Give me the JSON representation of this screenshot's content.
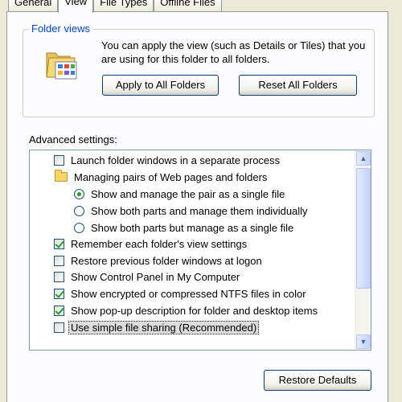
{
  "tabs": [
    {
      "label": "General",
      "active": false
    },
    {
      "label": "View",
      "active": true
    },
    {
      "label": "File Types",
      "active": false
    },
    {
      "label": "Offline Files",
      "active": false
    }
  ],
  "folder_views": {
    "title": "Folder views",
    "icon": "folder-views-icon",
    "description": "You can apply the view (such as Details or Tiles) that you are using for this folder to all folders.",
    "apply_label": "Apply to All Folders",
    "reset_label": "Reset All Folders"
  },
  "advanced": {
    "label": "Advanced settings:",
    "items": [
      {
        "type": "checkbox",
        "checked": false,
        "label": "Launch folder windows in a separate process"
      },
      {
        "type": "folder",
        "label": "Managing pairs of Web pages and folders"
      },
      {
        "type": "radio",
        "checked": true,
        "label": "Show and manage the pair as a single file"
      },
      {
        "type": "radio",
        "checked": false,
        "label": "Show both parts and manage them individually"
      },
      {
        "type": "radio",
        "checked": false,
        "label": "Show both parts but manage as a single file"
      },
      {
        "type": "checkbox",
        "checked": true,
        "label": "Remember each folder's view settings"
      },
      {
        "type": "checkbox",
        "checked": false,
        "label": "Restore previous folder windows at logon"
      },
      {
        "type": "checkbox",
        "checked": false,
        "label": "Show Control Panel in My Computer"
      },
      {
        "type": "checkbox",
        "checked": true,
        "label": "Show encrypted or compressed NTFS files in color"
      },
      {
        "type": "checkbox",
        "checked": true,
        "label": "Show pop-up description for folder and desktop items"
      },
      {
        "type": "checkbox",
        "checked": false,
        "label": "Use simple file sharing (Recommended)",
        "selected": true
      }
    ]
  },
  "restore_defaults_label": "Restore Defaults"
}
